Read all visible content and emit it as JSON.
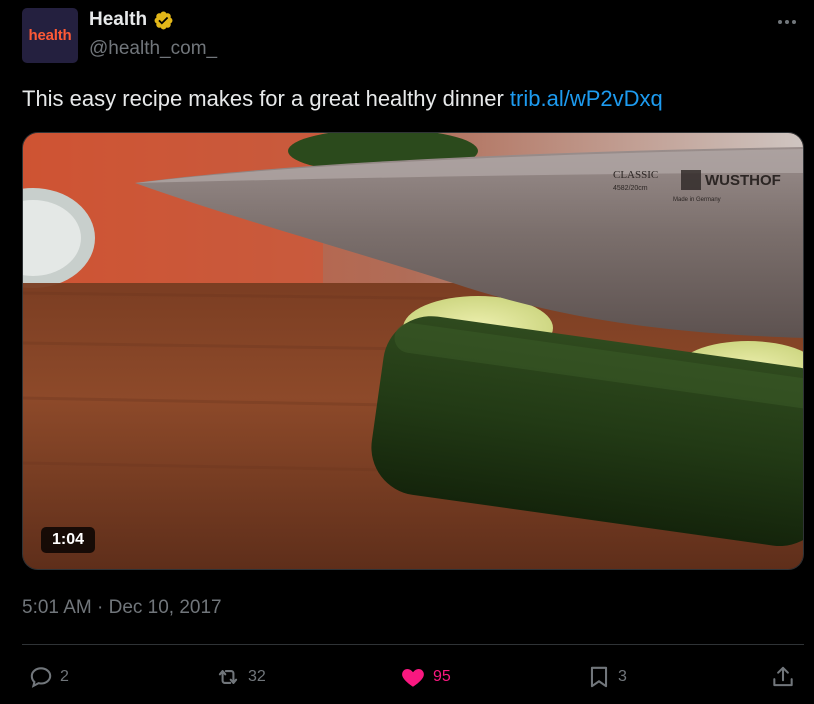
{
  "author": {
    "avatar_text": "health",
    "display_name": "Health",
    "handle": "@health_com_"
  },
  "tweet": {
    "text": "This easy recipe makes for a great healthy dinner ",
    "link": "trib.al/wP2vDxq",
    "timestamp": "5:01 AM · Dec 10, 2017"
  },
  "media": {
    "duration": "1:04",
    "knife_brand": "WUSTHOF",
    "knife_line": "CLASSIC",
    "knife_model": "4582/20cm",
    "knife_origin": "Made in Germany"
  },
  "actions": {
    "reply_count": "2",
    "retweet_count": "32",
    "like_count": "95",
    "bookmark_count": "3"
  },
  "colors": {
    "background": "#000000",
    "text_primary": "#e7e9ea",
    "text_secondary": "#71767b",
    "link": "#1d9bf0",
    "like_active": "#f91880",
    "verified_badge": "#e2b719",
    "avatar_bg": "#24203f",
    "avatar_text": "#ff5a36"
  },
  "icons": {
    "more": "more-horizontal-icon",
    "verified": "verified-gold-badge-icon",
    "reply": "speech-bubble-icon",
    "retweet": "retweet-icon",
    "like": "heart-filled-icon",
    "bookmark": "bookmark-icon",
    "share": "share-upload-icon"
  }
}
